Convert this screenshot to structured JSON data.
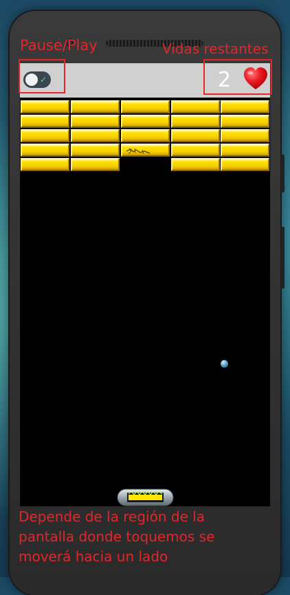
{
  "annotations": {
    "pause_play": "Pause/Play",
    "lives_left": "Vidas restantes",
    "controls_note_line1": "Depende de la región de la",
    "controls_note_line2": "pantalla donde toquemos se",
    "controls_note_line3": "moverá hacia un lado"
  },
  "game": {
    "lives": "2",
    "pause_toggle_state": "on",
    "brick_rows": [
      [
        1,
        1,
        1,
        1,
        1
      ],
      [
        1,
        1,
        1,
        1,
        1
      ],
      [
        1,
        1,
        1,
        1,
        1
      ],
      [
        1,
        1,
        1,
        1,
        1
      ],
      [
        1,
        1,
        0,
        1,
        1
      ]
    ],
    "cracked_brick": {
      "row": 3,
      "col": 2
    }
  },
  "colors": {
    "annotation": "#e3262b",
    "brick": "#ffe100",
    "top_bar": "#d0d0d0",
    "heart": "#e8161f"
  },
  "icons": {
    "toggle": "pause-play-toggle-icon",
    "heart": "heart-icon",
    "paddle": "paddle-icon",
    "ball": "ball-icon"
  }
}
